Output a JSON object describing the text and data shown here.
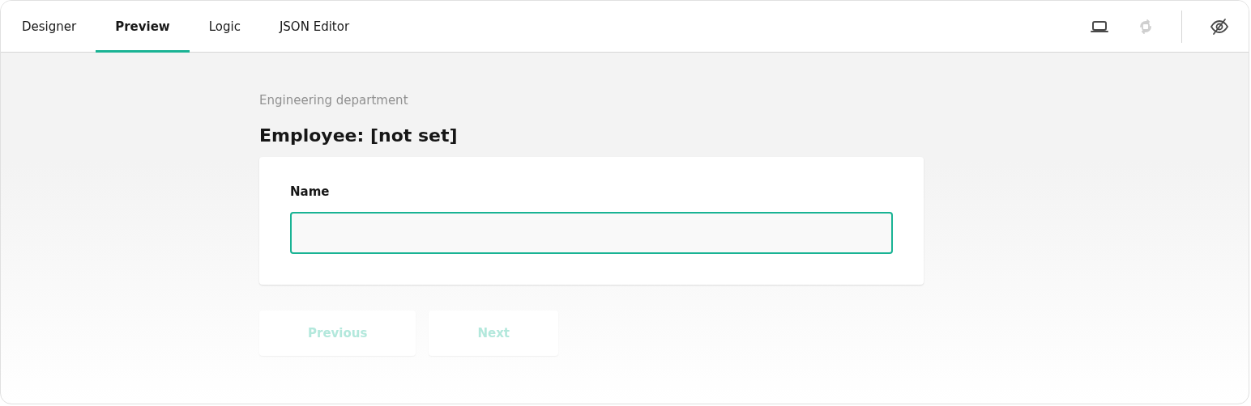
{
  "tabs": [
    {
      "label": "Designer",
      "selected": false
    },
    {
      "label": "Preview",
      "selected": true
    },
    {
      "label": "Logic",
      "selected": false
    },
    {
      "label": "JSON Editor",
      "selected": false
    }
  ],
  "toolbar": [
    {
      "kind": "laptop",
      "disabled": false
    },
    {
      "kind": "rotate",
      "disabled": true
    },
    {
      "kind": "eye-off",
      "disabled": false
    }
  ],
  "survey": {
    "description": "Engineering department",
    "title": "Employee: [not set]",
    "questions": [
      {
        "title": "Name",
        "focused": true
      }
    ]
  },
  "navigation": [
    {
      "label": "Previous",
      "disabled": true
    },
    {
      "label": "Next",
      "disabled": true
    }
  ]
}
